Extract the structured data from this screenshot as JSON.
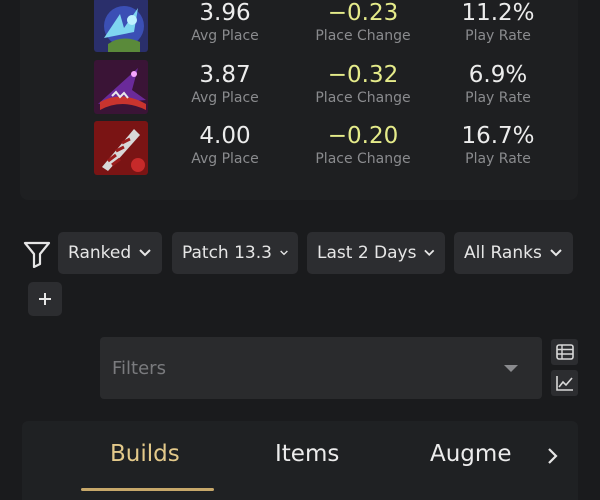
{
  "stats_rows": [
    {
      "icon": "blue-ice-splash-icon",
      "avg_place": "3.96",
      "avg_place_label": "Avg Place",
      "place_change": "−0.23",
      "place_change_label": "Place Change",
      "play_rate": "11.2%",
      "play_rate_label": "Play Rate"
    },
    {
      "icon": "purple-witch-hat-icon",
      "avg_place": "3.87",
      "avg_place_label": "Avg Place",
      "place_change": "−0.32",
      "place_change_label": "Place Change",
      "play_rate": "6.9%",
      "play_rate_label": "Play Rate"
    },
    {
      "icon": "red-feather-blade-icon",
      "avg_place": "4.00",
      "avg_place_label": "Avg Place",
      "place_change": "−0.20",
      "place_change_label": "Place Change",
      "play_rate": "16.7%",
      "play_rate_label": "Play Rate"
    }
  ],
  "filters": {
    "funnel_icon": "funnel-icon",
    "pills": [
      "Ranked",
      "Patch 13.3",
      "Last 2 Days",
      "All Ranks"
    ],
    "add_icon": "plus-icon",
    "search_placeholder": "Filters",
    "view_icons": [
      "table-view-icon",
      "chart-view-icon"
    ]
  },
  "tabs": {
    "items": [
      "Builds",
      "Items",
      "Augme"
    ],
    "active": "Builds",
    "next_icon": "chevron-right-icon"
  },
  "colors": {
    "background": "#1a1b1d",
    "card": "#1e1f21",
    "place_change": "#e5eb8a",
    "active_tab": "#e3c98a",
    "tab_underline": "#c7a86a",
    "label_grey": "#8a8b8e"
  }
}
